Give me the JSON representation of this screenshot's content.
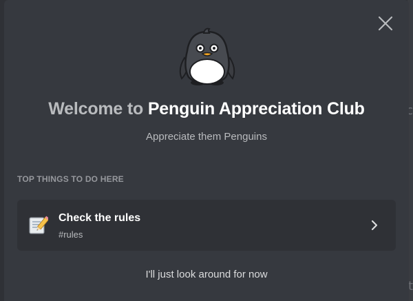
{
  "modal": {
    "title_prefix": "Welcome to ",
    "server_name": "Penguin Appreciation Club",
    "subtitle": "Appreciate them Penguins",
    "section_label": "TOP THINGS TO DO HERE",
    "action": {
      "title": "Check the rules",
      "channel": "#rules"
    },
    "skip_label": "I'll just look around for now"
  },
  "background": {
    "edge_glyph_a": "c",
    "edge_glyph_b": "t"
  },
  "icons": {
    "close": "close-icon",
    "mascot": "penguin-icon",
    "action": "memo-pencil-icon",
    "chevron": "chevron-right-icon"
  },
  "colors": {
    "modal_bg": "#36393f",
    "card_bg": "#2f3136",
    "title": "#ffffff",
    "muted": "#b9bbbe"
  }
}
